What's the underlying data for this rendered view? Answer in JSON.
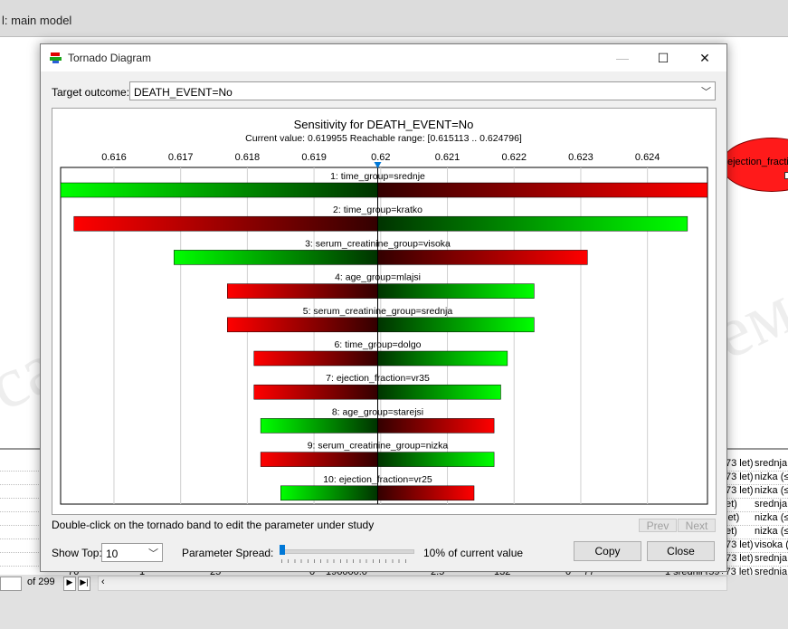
{
  "background": {
    "window_title": "l: main model",
    "node_label": "ejection_fractio",
    "watermark": [
      "ca",
      "ем"
    ],
    "table_rows": [
      {
        "a": "73 let)",
        "b": "srednja"
      },
      {
        "a": "73 let)",
        "b": "nizka (≤"
      },
      {
        "a": "73 let)",
        "b": "nizka (≤"
      },
      {
        "a": "et)",
        "b": "srednja"
      },
      {
        "a": "let)",
        "b": "nizka (≤"
      },
      {
        "a": "et)",
        "b": "nizka (≤"
      },
      {
        "a": "73 let)",
        "b": "visoka ("
      },
      {
        "a": "73 let)",
        "b": "srednja"
      }
    ],
    "last_row": {
      "c1": "76",
      "c2": "1",
      "c3": "25",
      "c4": "0",
      "c5": "196000.0",
      "c6": "2.5",
      "c7": "132",
      "c8": "0",
      "c9": "77",
      "c10": "1 srednji (59÷73 let)",
      "c11": "srednja"
    },
    "pager_of": "of 299"
  },
  "dialog": {
    "title": "Tornado Diagram",
    "target_label": "Target outcome:",
    "target_value": "DEATH_EVENT=No",
    "hint": "Double-click on the tornado band to edit the parameter under study",
    "prev_label": "Prev",
    "next_label": "Next",
    "show_top_label": "Show Top:",
    "show_top_value": "10",
    "spread_label": "Parameter Spread:",
    "spread_value": "10% of current value",
    "copy_label": "Copy",
    "close_label": "Close"
  },
  "chart_data": {
    "type": "tornado",
    "title": "Sensitivity for DEATH_EVENT=No",
    "subtitle": "Current value: 0.619955  Reachable range: [0.615113 .. 0.624796]",
    "current_value": 0.619955,
    "xlim": [
      0.6152,
      0.6249
    ],
    "ticks": [
      0.616,
      0.617,
      0.618,
      0.619,
      0.62,
      0.621,
      0.622,
      0.623,
      0.624
    ],
    "tick_labels": [
      "0.616",
      "0.617",
      "0.618",
      "0.619",
      "0.62",
      "0.621",
      "0.622",
      "0.623",
      "0.624"
    ],
    "bars": [
      {
        "label": "1: time_group=srednje",
        "low": 0.6152,
        "high": 0.6249,
        "left_color": "green"
      },
      {
        "label": "2: time_group=kratko",
        "low": 0.6154,
        "high": 0.6246,
        "left_color": "red"
      },
      {
        "label": "3: serum_creatinine_group=visoka",
        "low": 0.6169,
        "high": 0.6231,
        "left_color": "green"
      },
      {
        "label": "4: age_group=mlajsi",
        "low": 0.6177,
        "high": 0.6223,
        "left_color": "red"
      },
      {
        "label": "5: serum_creatinine_group=srednja",
        "low": 0.6177,
        "high": 0.6223,
        "left_color": "red"
      },
      {
        "label": "6: time_group=dolgo",
        "low": 0.6181,
        "high": 0.6219,
        "left_color": "red"
      },
      {
        "label": "7: ejection_fraction=vr35",
        "low": 0.6181,
        "high": 0.6218,
        "left_color": "red"
      },
      {
        "label": "8: age_group=starejsi",
        "low": 0.6182,
        "high": 0.6217,
        "left_color": "green"
      },
      {
        "label": "9: serum_creatinine_group=nizka",
        "low": 0.6182,
        "high": 0.6217,
        "left_color": "red"
      },
      {
        "label": "10: ejection_fraction=vr25",
        "low": 0.6185,
        "high": 0.6214,
        "left_color": "green"
      }
    ],
    "colors": {
      "green": "#00ff00",
      "red": "#ff0000",
      "dark_green": "#003300",
      "dark_red": "#330000",
      "marker": "#0078d7"
    }
  }
}
